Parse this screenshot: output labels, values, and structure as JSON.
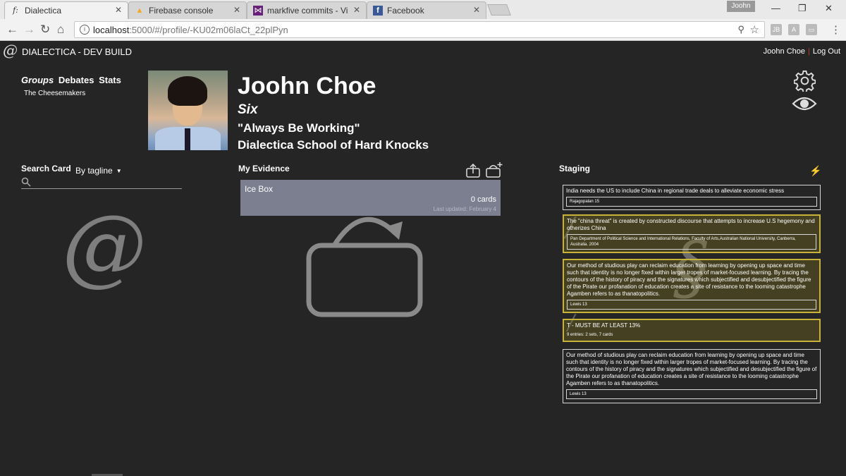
{
  "browser": {
    "tabs": [
      {
        "title": "Dialectica",
        "favicon": "f:",
        "active": true
      },
      {
        "title": "Firebase console",
        "favicon": "firebase-icon",
        "active": false
      },
      {
        "title": "markfive commits - Visu",
        "favicon": "vs-icon",
        "active": false
      },
      {
        "title": "Facebook",
        "favicon": "facebook-icon",
        "active": false
      }
    ],
    "profile_name": "Joohn",
    "url_host": "localhost",
    "url_path": ":5000/#/profile/-KU02m06laCt_22plPyn",
    "window_controls": [
      "minimize",
      "maximize",
      "close"
    ]
  },
  "app": {
    "logo": "@",
    "title": "DIALECTICA - DEV BUILD",
    "user_name": "Joohn Choe",
    "logout_label": "Log Out"
  },
  "nav": {
    "groups_label": "Groups",
    "debates_label": "Debates",
    "stats_label": "Stats",
    "team": "The Cheesemakers"
  },
  "profile": {
    "name": "Joohn Choe",
    "rank": "Six",
    "motto": "\"Always Be Working\"",
    "school": "Dialectica School of Hard Knocks"
  },
  "search": {
    "label": "Search Card",
    "mode": "By tagline",
    "placeholder": "",
    "empty_glyph": "@"
  },
  "evidence": {
    "label": "My Evidence",
    "boxes": [
      {
        "name": "Ice Box",
        "count": "0 cards",
        "updated": "Last updated: February 4"
      }
    ]
  },
  "staging": {
    "label": "Staging",
    "cards": [
      {
        "tag": "India needs the US to include China in regional trade deals to alleviate economic stress",
        "cite": "Rajagopalan 15",
        "highlighted": false
      },
      {
        "tag": "The \"china threat\" is created by constructed discourse that attempts to increase U.S hegemony and otherizes China",
        "cite": "Pan Department of Political Science and International Relations, Faculty of Arts,Australian National University, Canberra, Australia. 2004",
        "highlighted": true
      },
      {
        "tag": "Our method of studious play can reclaim education from learning by opening up space and time such that identity is no longer fixed within larger tropes of market-focused learning. By tracing the contours of the history of piracy and the signatures which subjectified and desubjectified the figure of the Pirate our profanation of education creates a site of resistance to the looming catastrophe Agamben refers to as thanatopolitics.",
        "cite": "Lewis 13",
        "highlighted": true
      },
      {
        "tag": "T - MUST BE AT LEAST 13%",
        "meta": "9 entries: 2 sets, 7 cards",
        "highlighted": true
      },
      {
        "tag": "Our method of studious play can reclaim education from learning by opening up space and time such that identity is no longer fixed within larger tropes of market-focused learning. By tracing the contours of the history of piracy and the signatures which subjectified and desubjectified the figure of the Pirate our profanation of education creates a site of resistance to the looming catastrophe Agamben refers to as thanatopolitics.",
        "cite": "Lewis 13",
        "highlighted": false
      }
    ],
    "glyph": "§"
  },
  "colors": {
    "background": "#252525",
    "box_card": "#7c7f90",
    "highlight_border": "#c9b23a",
    "logout_separator": "#c0392b"
  }
}
